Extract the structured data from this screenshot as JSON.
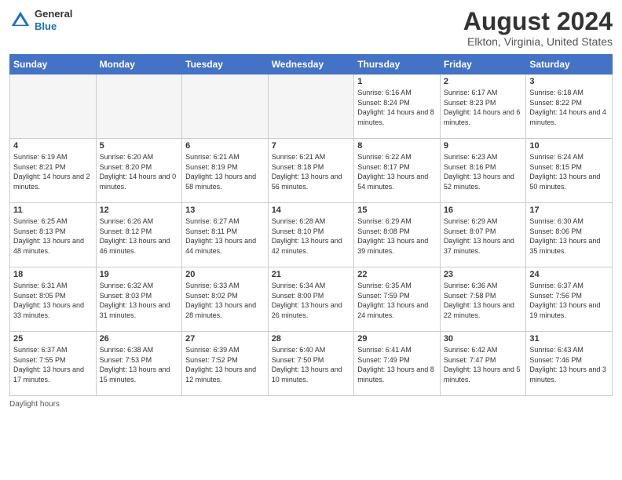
{
  "logo": {
    "general": "General",
    "blue": "Blue"
  },
  "title": "August 2024",
  "location": "Elkton, Virginia, United States",
  "days_header": [
    "Sunday",
    "Monday",
    "Tuesday",
    "Wednesday",
    "Thursday",
    "Friday",
    "Saturday"
  ],
  "footer": "Daylight hours",
  "weeks": [
    [
      {
        "num": "",
        "info": ""
      },
      {
        "num": "",
        "info": ""
      },
      {
        "num": "",
        "info": ""
      },
      {
        "num": "",
        "info": ""
      },
      {
        "num": "1",
        "info": "Sunrise: 6:16 AM\nSunset: 8:24 PM\nDaylight: 14 hours\nand 8 minutes."
      },
      {
        "num": "2",
        "info": "Sunrise: 6:17 AM\nSunset: 8:23 PM\nDaylight: 14 hours\nand 6 minutes."
      },
      {
        "num": "3",
        "info": "Sunrise: 6:18 AM\nSunset: 8:22 PM\nDaylight: 14 hours\nand 4 minutes."
      }
    ],
    [
      {
        "num": "4",
        "info": "Sunrise: 6:19 AM\nSunset: 8:21 PM\nDaylight: 14 hours\nand 2 minutes."
      },
      {
        "num": "5",
        "info": "Sunrise: 6:20 AM\nSunset: 8:20 PM\nDaylight: 14 hours\nand 0 minutes."
      },
      {
        "num": "6",
        "info": "Sunrise: 6:21 AM\nSunset: 8:19 PM\nDaylight: 13 hours\nand 58 minutes."
      },
      {
        "num": "7",
        "info": "Sunrise: 6:21 AM\nSunset: 8:18 PM\nDaylight: 13 hours\nand 56 minutes."
      },
      {
        "num": "8",
        "info": "Sunrise: 6:22 AM\nSunset: 8:17 PM\nDaylight: 13 hours\nand 54 minutes."
      },
      {
        "num": "9",
        "info": "Sunrise: 6:23 AM\nSunset: 8:16 PM\nDaylight: 13 hours\nand 52 minutes."
      },
      {
        "num": "10",
        "info": "Sunrise: 6:24 AM\nSunset: 8:15 PM\nDaylight: 13 hours\nand 50 minutes."
      }
    ],
    [
      {
        "num": "11",
        "info": "Sunrise: 6:25 AM\nSunset: 8:13 PM\nDaylight: 13 hours\nand 48 minutes."
      },
      {
        "num": "12",
        "info": "Sunrise: 6:26 AM\nSunset: 8:12 PM\nDaylight: 13 hours\nand 46 minutes."
      },
      {
        "num": "13",
        "info": "Sunrise: 6:27 AM\nSunset: 8:11 PM\nDaylight: 13 hours\nand 44 minutes."
      },
      {
        "num": "14",
        "info": "Sunrise: 6:28 AM\nSunset: 8:10 PM\nDaylight: 13 hours\nand 42 minutes."
      },
      {
        "num": "15",
        "info": "Sunrise: 6:29 AM\nSunset: 8:08 PM\nDaylight: 13 hours\nand 39 minutes."
      },
      {
        "num": "16",
        "info": "Sunrise: 6:29 AM\nSunset: 8:07 PM\nDaylight: 13 hours\nand 37 minutes."
      },
      {
        "num": "17",
        "info": "Sunrise: 6:30 AM\nSunset: 8:06 PM\nDaylight: 13 hours\nand 35 minutes."
      }
    ],
    [
      {
        "num": "18",
        "info": "Sunrise: 6:31 AM\nSunset: 8:05 PM\nDaylight: 13 hours\nand 33 minutes."
      },
      {
        "num": "19",
        "info": "Sunrise: 6:32 AM\nSunset: 8:03 PM\nDaylight: 13 hours\nand 31 minutes."
      },
      {
        "num": "20",
        "info": "Sunrise: 6:33 AM\nSunset: 8:02 PM\nDaylight: 13 hours\nand 28 minutes."
      },
      {
        "num": "21",
        "info": "Sunrise: 6:34 AM\nSunset: 8:00 PM\nDaylight: 13 hours\nand 26 minutes."
      },
      {
        "num": "22",
        "info": "Sunrise: 6:35 AM\nSunset: 7:59 PM\nDaylight: 13 hours\nand 24 minutes."
      },
      {
        "num": "23",
        "info": "Sunrise: 6:36 AM\nSunset: 7:58 PM\nDaylight: 13 hours\nand 22 minutes."
      },
      {
        "num": "24",
        "info": "Sunrise: 6:37 AM\nSunset: 7:56 PM\nDaylight: 13 hours\nand 19 minutes."
      }
    ],
    [
      {
        "num": "25",
        "info": "Sunrise: 6:37 AM\nSunset: 7:55 PM\nDaylight: 13 hours\nand 17 minutes."
      },
      {
        "num": "26",
        "info": "Sunrise: 6:38 AM\nSunset: 7:53 PM\nDaylight: 13 hours\nand 15 minutes."
      },
      {
        "num": "27",
        "info": "Sunrise: 6:39 AM\nSunset: 7:52 PM\nDaylight: 13 hours\nand 12 minutes."
      },
      {
        "num": "28",
        "info": "Sunrise: 6:40 AM\nSunset: 7:50 PM\nDaylight: 13 hours\nand 10 minutes."
      },
      {
        "num": "29",
        "info": "Sunrise: 6:41 AM\nSunset: 7:49 PM\nDaylight: 13 hours\nand 8 minutes."
      },
      {
        "num": "30",
        "info": "Sunrise: 6:42 AM\nSunset: 7:47 PM\nDaylight: 13 hours\nand 5 minutes."
      },
      {
        "num": "31",
        "info": "Sunrise: 6:43 AM\nSunset: 7:46 PM\nDaylight: 13 hours\nand 3 minutes."
      }
    ]
  ]
}
